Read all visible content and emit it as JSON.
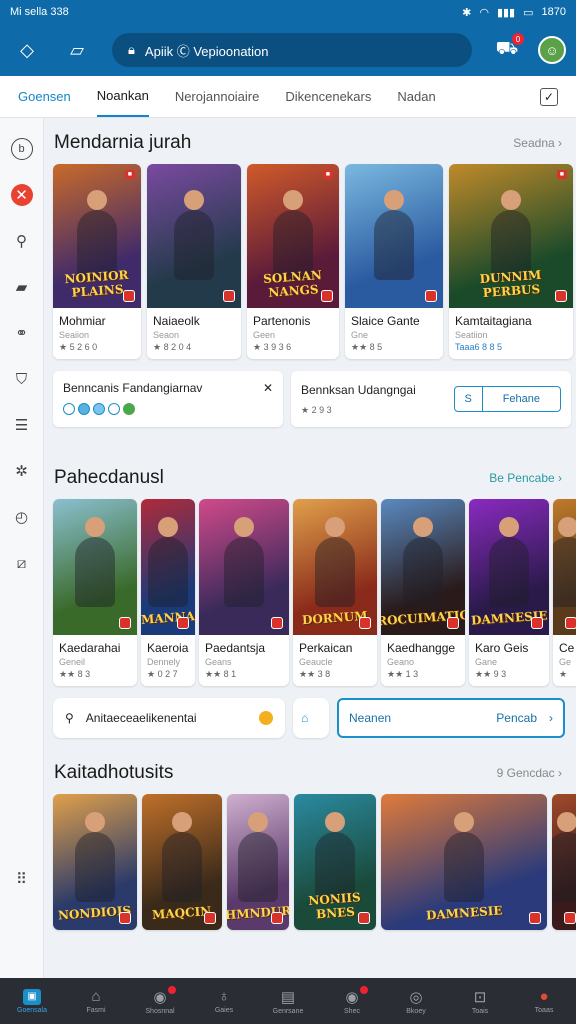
{
  "status": {
    "left": "Mi sella 338",
    "time": "1870"
  },
  "header": {
    "address": "Apiik Ⓒ Vepioonation",
    "cart_badge": "0"
  },
  "tabs": [
    "Goensen",
    "Noankan",
    "Nerojannoiaire",
    "Dikencenekars",
    "Nadan"
  ],
  "sidebar": [
    "b",
    "x",
    "q",
    "bag",
    "link",
    "shield",
    "list",
    "gear",
    "clock",
    "edit",
    "dots"
  ],
  "section1": {
    "title": "Mendarnia jurah",
    "link": "Seadna  ›",
    "cards": [
      {
        "name": "Mohmiar",
        "sub": "Seaiion",
        "rating": "★ 5 2 6 0",
        "art": "NOINIOR PLAINS",
        "c1": "#3f2a6a",
        "c2": "#c96a2a"
      },
      {
        "name": "Naiaeolk",
        "sub": "Seaon",
        "rating": "★ 8 2 0 4",
        "art": "",
        "c1": "#233a4a",
        "c2": "#7a4aa0"
      },
      {
        "name": "Partenonis",
        "sub": "Geen",
        "rating": "★ 3 9 3 6",
        "art": "SOLNAN NANGS",
        "c1": "#5a1a3a",
        "c2": "#d05a2a"
      },
      {
        "name": "Slaice Gante",
        "sub": "Gne",
        "rating": "★★ 8 5",
        "art": "",
        "c1": "#2a5aa0",
        "c2": "#7ab8e0"
      },
      {
        "name": "Kamtaitagiana",
        "sub": "Seatiion",
        "rating": "Taaa6 8 8 5",
        "art": "DUNNIM PERBUS",
        "c1": "#1a4a2a",
        "c2": "#c08a2a",
        "blue": true
      }
    ]
  },
  "info1": {
    "title": "Benncanis Fandangiarnav",
    "close": "✕"
  },
  "info2": {
    "title": "Bennksan Udangngai",
    "rating": "★ 2 9 3",
    "button": "Fehane"
  },
  "section2": {
    "title": "Pahecdanusl",
    "link": "Be Pencabe  ›",
    "cards": [
      {
        "name": "Kaedarahai",
        "sub": "Geneil",
        "rating": "★★ 8 3",
        "art": "",
        "c1": "#3a6a2a",
        "c2": "#8ac0d0"
      },
      {
        "name": "Kaeroia",
        "sub": "Dennely",
        "rating": "★ 0 2 7",
        "art": "MANNA",
        "c1": "#1a3a7a",
        "c2": "#b02a3a"
      },
      {
        "name": "Paedantsja",
        "sub": "Geans",
        "rating": "★★ 8 1",
        "art": "",
        "c1": "#3a2a5a",
        "c2": "#d04a8a"
      },
      {
        "name": "Perkaican",
        "sub": "Geaucle",
        "rating": "★★ 3 8",
        "art": "DORNUM",
        "c1": "#8a2a1a",
        "c2": "#e0a04a"
      },
      {
        "name": "Kaedhangge",
        "sub": "Geano",
        "rating": "★★ 1 3",
        "art": "ROCUIMATIC",
        "c1": "#2a1a1a",
        "c2": "#5a8ac0"
      },
      {
        "name": "Karo Geis",
        "sub": "Gane",
        "rating": "★★ 9 3",
        "art": "DAMNESIE",
        "c1": "#2a1a4a",
        "c2": "#8a2ac0"
      },
      {
        "name": "Ce",
        "sub": "Ge",
        "rating": "★",
        "art": "",
        "c1": "#5a3a1a",
        "c2": "#c07a2a"
      }
    ]
  },
  "search": {
    "value": "Anitaeceaelikenentai"
  },
  "cta": {
    "label": "Neanen",
    "secondary": "Pencab"
  },
  "section3": {
    "title": "Kaitadhotusits",
    "link": "9 Gencdac  ›",
    "cards": [
      {
        "art": "NONDIOIS",
        "c1": "#2a3a6a",
        "c2": "#e0a04a"
      },
      {
        "art": "MAQCIN",
        "c1": "#3a2a1a",
        "c2": "#c0702a"
      },
      {
        "art": "THMNDURS",
        "c1": "#5a3a6a",
        "c2": "#d0b0d0"
      },
      {
        "art": "NONIIS BNES",
        "c1": "#1a4a3a",
        "c2": "#2a8aa0"
      },
      {
        "art": "DAMNESIE",
        "c1": "#2a3a7a",
        "c2": "#e07a3a"
      },
      {
        "art": "",
        "c1": "#3a1a1a",
        "c2": "#a04a2a"
      }
    ]
  },
  "bottom_nav": [
    {
      "label": "Goensala",
      "icon": "▣",
      "active": true
    },
    {
      "label": "Fasmi",
      "icon": "⌂"
    },
    {
      "label": "Shosnnal",
      "icon": "◉",
      "badge": true
    },
    {
      "label": "Gaies",
      "icon": "♁"
    },
    {
      "label": "Genrsane",
      "icon": "▤"
    },
    {
      "label": "Shec",
      "icon": "◉",
      "badge": true
    },
    {
      "label": "Bkoey",
      "icon": "◎"
    },
    {
      "label": "Toais",
      "icon": "⊡"
    },
    {
      "label": "Toaas",
      "icon": "●",
      "red": true
    }
  ],
  "colors": {
    "primary": "#0f6aa9",
    "accent": "#1a8fc9",
    "badge": "#d9322b",
    "nav_bg": "#2a2d33"
  }
}
